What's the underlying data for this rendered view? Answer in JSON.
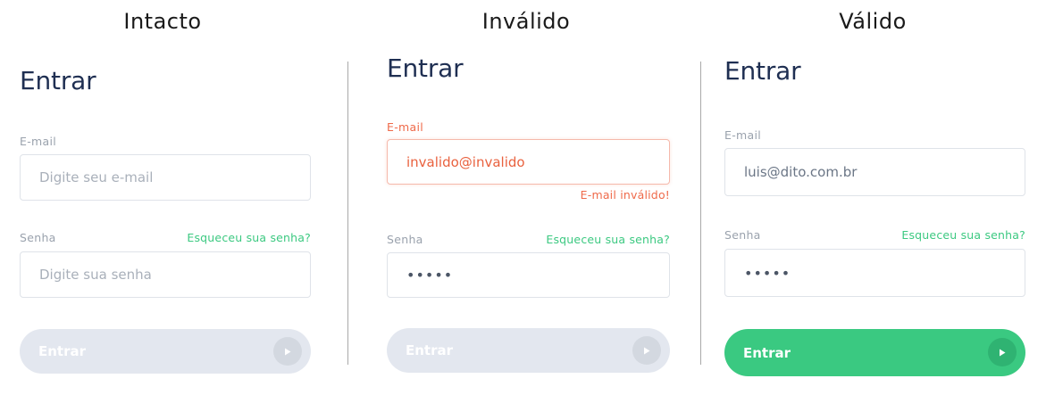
{
  "states": [
    {
      "heading": "Intacto",
      "title": "Entrar",
      "email_label": "E-mail",
      "email_placeholder": "Digite seu e-mail",
      "password_label": "Senha",
      "forgot_link": "Esqueceu sua senha?",
      "password_placeholder": "Digite sua senha",
      "button_label": "Entrar",
      "button_enabled": false
    },
    {
      "heading": "Inválido",
      "title": "Entrar",
      "email_label": "E-mail",
      "email_value": "invalido@invalido",
      "email_error": "E-mail inválido!",
      "password_label": "Senha",
      "forgot_link": "Esqueceu sua senha?",
      "password_value": "•••••",
      "button_label": "Entrar",
      "button_enabled": false
    },
    {
      "heading": "Válido",
      "title": "Entrar",
      "email_label": "E-mail",
      "email_value": "luis@dito.com.br",
      "password_label": "Senha",
      "forgot_link": "Esqueceu sua senha?",
      "password_value": "•••••",
      "button_label": "Entrar",
      "button_enabled": true
    }
  ],
  "colors": {
    "title": "#1f2f52",
    "accent_green": "#3ac981",
    "error": "#ef6a4a",
    "disabled_button": "#e3e7ef"
  },
  "icons": {
    "button_icon": "play-icon"
  }
}
